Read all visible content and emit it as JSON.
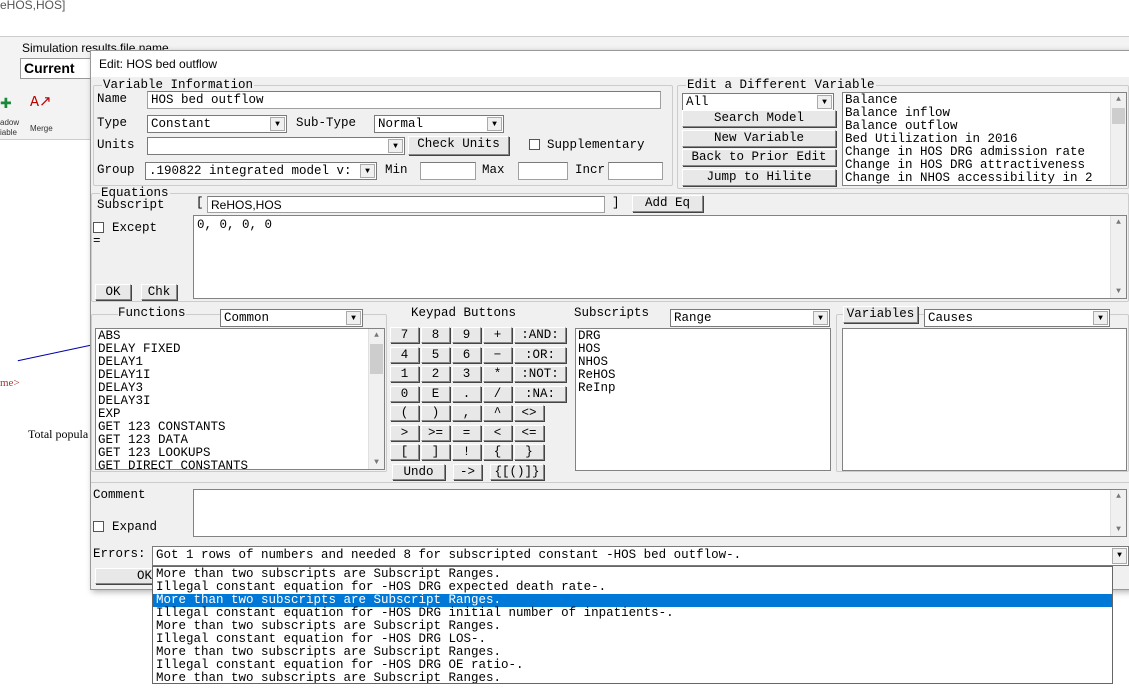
{
  "background": {
    "window_title_fragment": "eHOS,HOS]",
    "sim_label": "Simulation results file name",
    "sim_value": "Current",
    "tool_shadow": "adow\niable",
    "tool_merge": "Merge",
    "diagram_text1": "me>",
    "diagram_text2": "Total popula"
  },
  "dialog": {
    "title": "Edit: HOS bed outflow",
    "var_info": {
      "group_label": "Variable Information",
      "name_label": "Name",
      "name_value": "HOS bed outflow",
      "type_label": "Type",
      "type_value": "Constant",
      "subtype_label": "Sub-Type",
      "subtype_value": "Normal",
      "units_label": "Units",
      "units_value": "",
      "check_units": "Check Units",
      "supplementary": "Supplementary",
      "group_field_label": "Group",
      "group_value": ".190822 integrated model v:",
      "min_label": "Min",
      "max_label": "Max",
      "incr_label": "Incr"
    },
    "edit_other": {
      "group_label": "Edit a Different Variable",
      "filter_value": "All",
      "buttons": [
        "Search Model",
        "New Variable",
        "Back to Prior Edit",
        "Jump to Hilite"
      ],
      "variables": [
        "Balance",
        "Balance inflow",
        "Balance outflow",
        "Bed Utilization in 2016",
        "Change in HOS DRG admission rate",
        "Change in HOS DRG attractiveness",
        "Change in NHOS accessibility in 2"
      ]
    },
    "equations": {
      "group_label": "Equations",
      "subscript_label": "Subscript",
      "bracket_open": "[",
      "subscript_value": "ReHOS,HOS",
      "bracket_close": "]",
      "add_eq": "Add Eq",
      "except_label": "Except",
      "equals": "=",
      "equation": "0, 0, 0, 0",
      "ok": "OK",
      "chk": "Chk"
    },
    "functions": {
      "label": "Functions",
      "filter": "Common",
      "items": [
        "ABS",
        "DELAY FIXED",
        "DELAY1",
        "DELAY1I",
        "DELAY3",
        "DELAY3I",
        "EXP",
        "GET 123 CONSTANTS",
        "GET 123 DATA",
        "GET 123 LOOKUPS",
        "GET DIRECT CONSTANTS"
      ]
    },
    "keypad": {
      "label": "Keypad Buttons",
      "rows": [
        [
          "7",
          "8",
          "9",
          "+",
          ":AND:"
        ],
        [
          "4",
          "5",
          "6",
          "−",
          ":OR:"
        ],
        [
          "1",
          "2",
          "3",
          "*",
          ":NOT:"
        ],
        [
          "0",
          "E",
          ".",
          "/",
          ":NA:"
        ],
        [
          "(",
          ")",
          ",",
          "^",
          "<>"
        ],
        [
          ">",
          ">=",
          "=",
          "<",
          "<="
        ],
        [
          "[",
          "]",
          "!",
          "{",
          "}"
        ]
      ],
      "last_row": [
        "Undo",
        "->",
        "{[()]}"
      ]
    },
    "subscripts": {
      "label": "Subscripts",
      "filter": "Range",
      "items": [
        "DRG",
        "HOS",
        "NHOS",
        "ReHOS",
        "ReInp"
      ]
    },
    "variables": {
      "button": "Variables",
      "filter": "Causes",
      "items": []
    },
    "comment": {
      "label": "Comment",
      "value": "",
      "expand": "Expand"
    },
    "errors": {
      "label": "Errors:",
      "value": "Got 1 rows of numbers and needed 8 for subscripted constant -HOS bed outflow-.",
      "ok": "OK",
      "selected_index": 2,
      "list": [
        "More than two subscripts are Subscript Ranges.",
        "Illegal constant equation for -HOS DRG expected death rate-.",
        "More than two subscripts are Subscript Ranges.",
        "Illegal constant equation for -HOS DRG initial number of inpatients-.",
        "More than two subscripts are Subscript Ranges.",
        "Illegal constant equation for -HOS DRG LOS-.",
        "More than two subscripts are Subscript Ranges.",
        "Illegal constant equation for -HOS DRG OE ratio-.",
        "More than two subscripts are Subscript Ranges."
      ]
    }
  }
}
